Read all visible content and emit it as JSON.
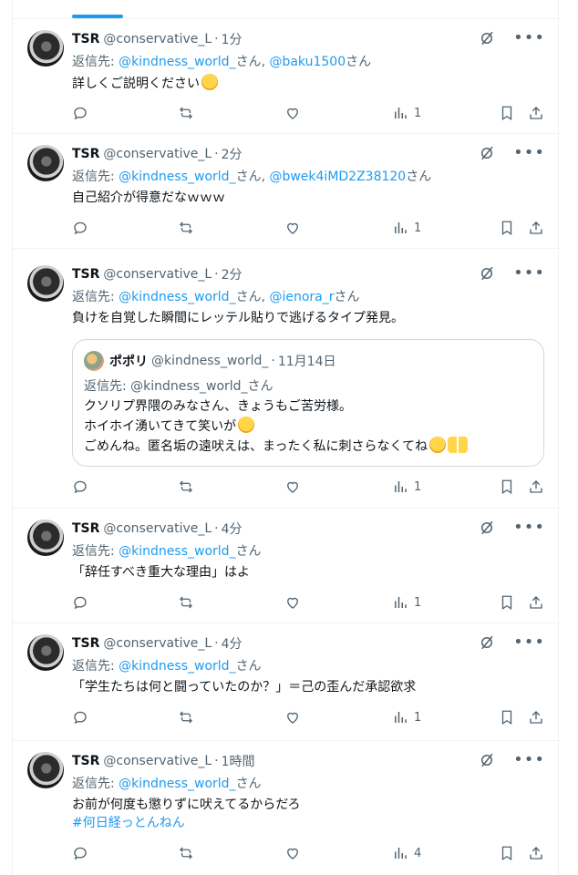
{
  "author": {
    "name": "TSR",
    "handle": "@conservative_L",
    "separator": "·"
  },
  "reply_prefix": "返信先:",
  "san": "さん",
  "comma": ", ",
  "posts": [
    {
      "time": "1分",
      "reply_mentions": [
        "@kindness_world_",
        "@baku1500"
      ],
      "text": "詳しくご説明ください",
      "emoji": "hug",
      "views": "1"
    },
    {
      "time": "2分",
      "reply_mentions": [
        "@kindness_world_",
        "@bwek4iMD2Z38120"
      ],
      "text": "自己紹介が得意だなｗｗｗ",
      "views": "1"
    },
    {
      "time": "2分",
      "reply_mentions": [
        "@kindness_world_",
        "@ienora_r"
      ],
      "text": "負けを自覚した瞬間にレッテル貼りで逃げるタイプ発見。",
      "views": "1",
      "quote": {
        "name": "ポポリ",
        "handle": "@kindness_world_",
        "date": "11月14日",
        "reply_to": "返信先: @kindness_world_さん",
        "lines": [
          "クソリプ界隈のみなさん、きょうもご苦労様。",
          "ホイホイ湧いてきて笑いが",
          "ごめんね。匿名垢の遠吠えは、まったく私に刺さらなくてね"
        ]
      }
    },
    {
      "time": "4分",
      "reply_mentions": [
        "@kindness_world_"
      ],
      "text": "「辞任すべき重大な理由」はよ",
      "views": "1"
    },
    {
      "time": "4分",
      "reply_mentions": [
        "@kindness_world_"
      ],
      "text": "「学生たちは何と闘っていたのか？」＝己の歪んだ承認欲求",
      "views": "1"
    },
    {
      "time": "1時間",
      "reply_mentions": [
        "@kindness_world_"
      ],
      "text": "お前が何度も懲りずに吠えてるからだろ",
      "hashtag": "#何日経っとんねん",
      "views": "4"
    }
  ],
  "icons": [
    "grok-icon",
    "more-icon",
    "reply-icon",
    "repost-icon",
    "like-icon",
    "views-icon",
    "bookmark-icon",
    "share-icon"
  ],
  "colors": {
    "link": "#1d9bf0",
    "muted": "#536471",
    "text": "#0f1419",
    "border": "#eff3f4"
  }
}
